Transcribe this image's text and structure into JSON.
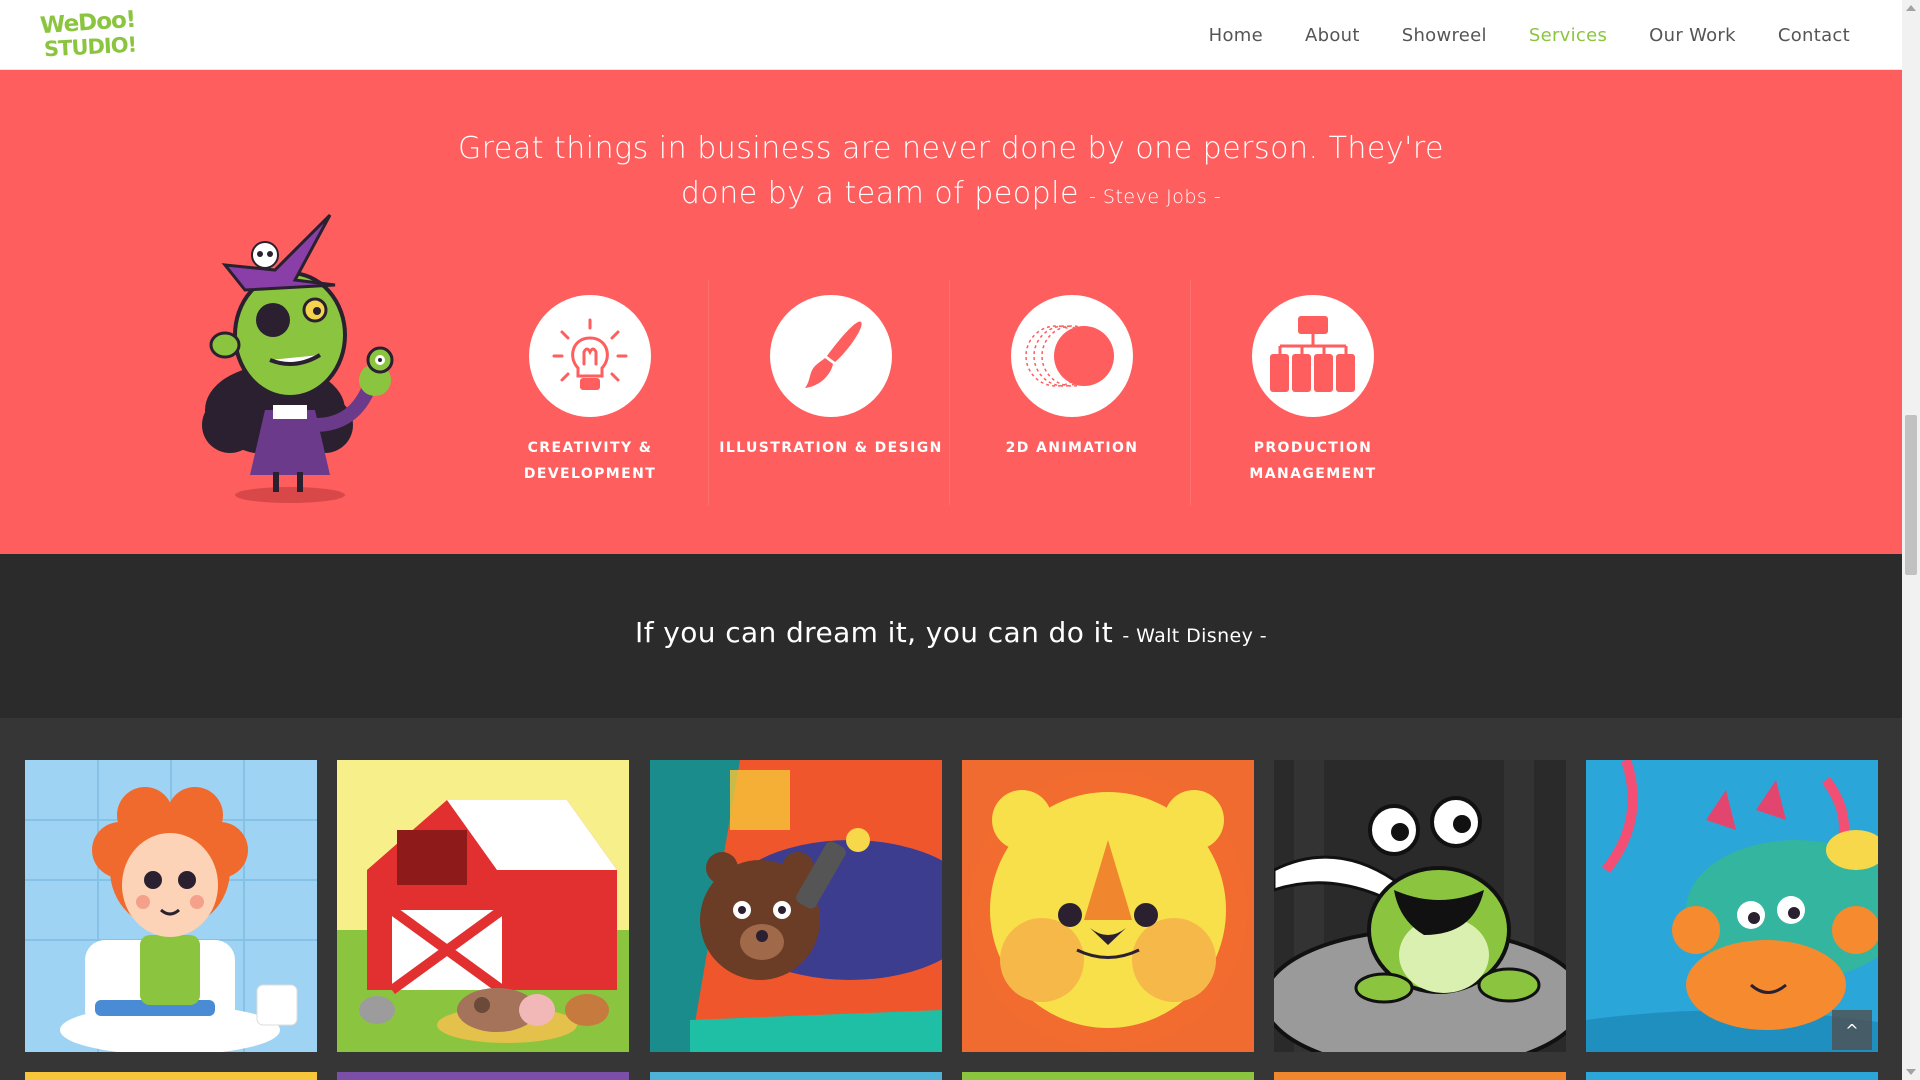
{
  "logo": {
    "line1": "WeDoo!",
    "line2": "STUDIO!"
  },
  "nav": {
    "items": [
      {
        "label": "Home",
        "active": false
      },
      {
        "label": "About",
        "active": false
      },
      {
        "label": "Showreel",
        "active": false
      },
      {
        "label": "Services",
        "active": true
      },
      {
        "label": "Our Work",
        "active": false
      },
      {
        "label": "Contact",
        "active": false
      }
    ]
  },
  "services": {
    "quote_line1": "Great things in business are never done by one person. They're",
    "quote_line2": "done by a team of people",
    "quote_author": "- Steve Jobs -",
    "items": [
      {
        "label_line1": "CREATIVITY &",
        "label_line2": "DEVELOPMENT",
        "icon": "lightbulb-icon"
      },
      {
        "label_line1": "ILLUSTRATION & DESIGN",
        "label_line2": "",
        "icon": "paintbrush-icon"
      },
      {
        "label_line1": "2D ANIMATION",
        "label_line2": "",
        "icon": "animation-icon"
      },
      {
        "label_line1": "PRODUCTION",
        "label_line2": "MANAGEMENT",
        "icon": "org-chart-icon"
      }
    ]
  },
  "band": {
    "quote": "If you can dream it, you can do it",
    "author": "- Walt Disney -"
  },
  "gallery": {
    "tiles": [
      {
        "name": "potty-boy-illustration"
      },
      {
        "name": "farm-barn-illustration"
      },
      {
        "name": "bear-flashlight-illustration"
      },
      {
        "name": "lion-face-illustration"
      },
      {
        "name": "frog-illustration"
      },
      {
        "name": "crab-illustration"
      }
    ]
  },
  "colors": {
    "accent": "#8bc53f",
    "services_bg": "#fe5e5e",
    "band_bg": "#2b2b2b",
    "gallery_bg": "#363636"
  },
  "scroll_to_top": "^"
}
